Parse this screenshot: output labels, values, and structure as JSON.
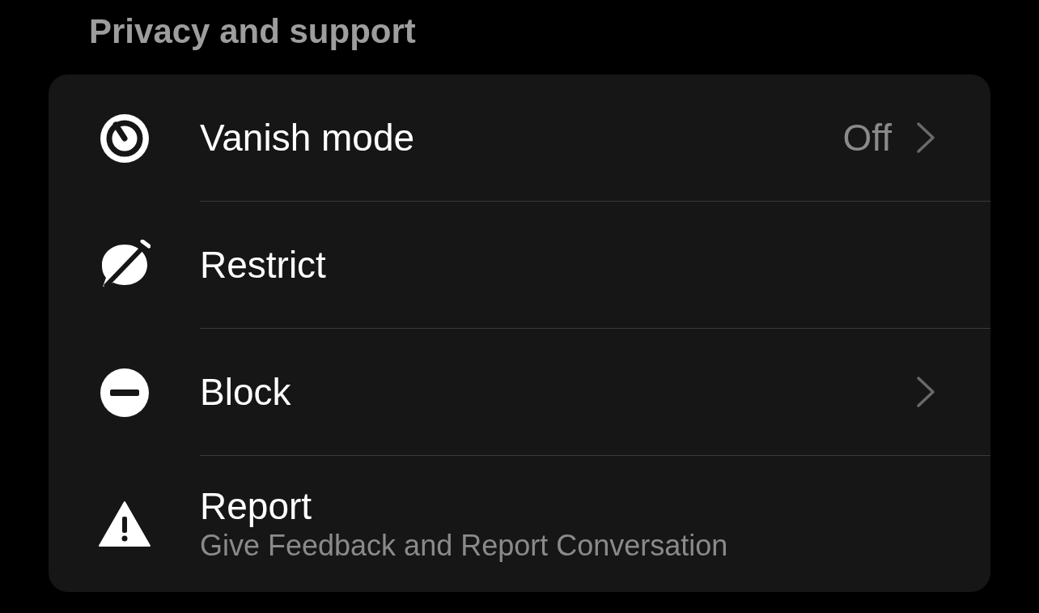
{
  "section_title": "Privacy and support",
  "items": [
    {
      "label": "Vanish mode",
      "value": "Off",
      "chevron": true
    },
    {
      "label": "Restrict",
      "chevron": false
    },
    {
      "label": "Block",
      "chevron": true
    },
    {
      "label": "Report",
      "subtitle": "Give Feedback and Report Conversation",
      "chevron": false
    }
  ]
}
